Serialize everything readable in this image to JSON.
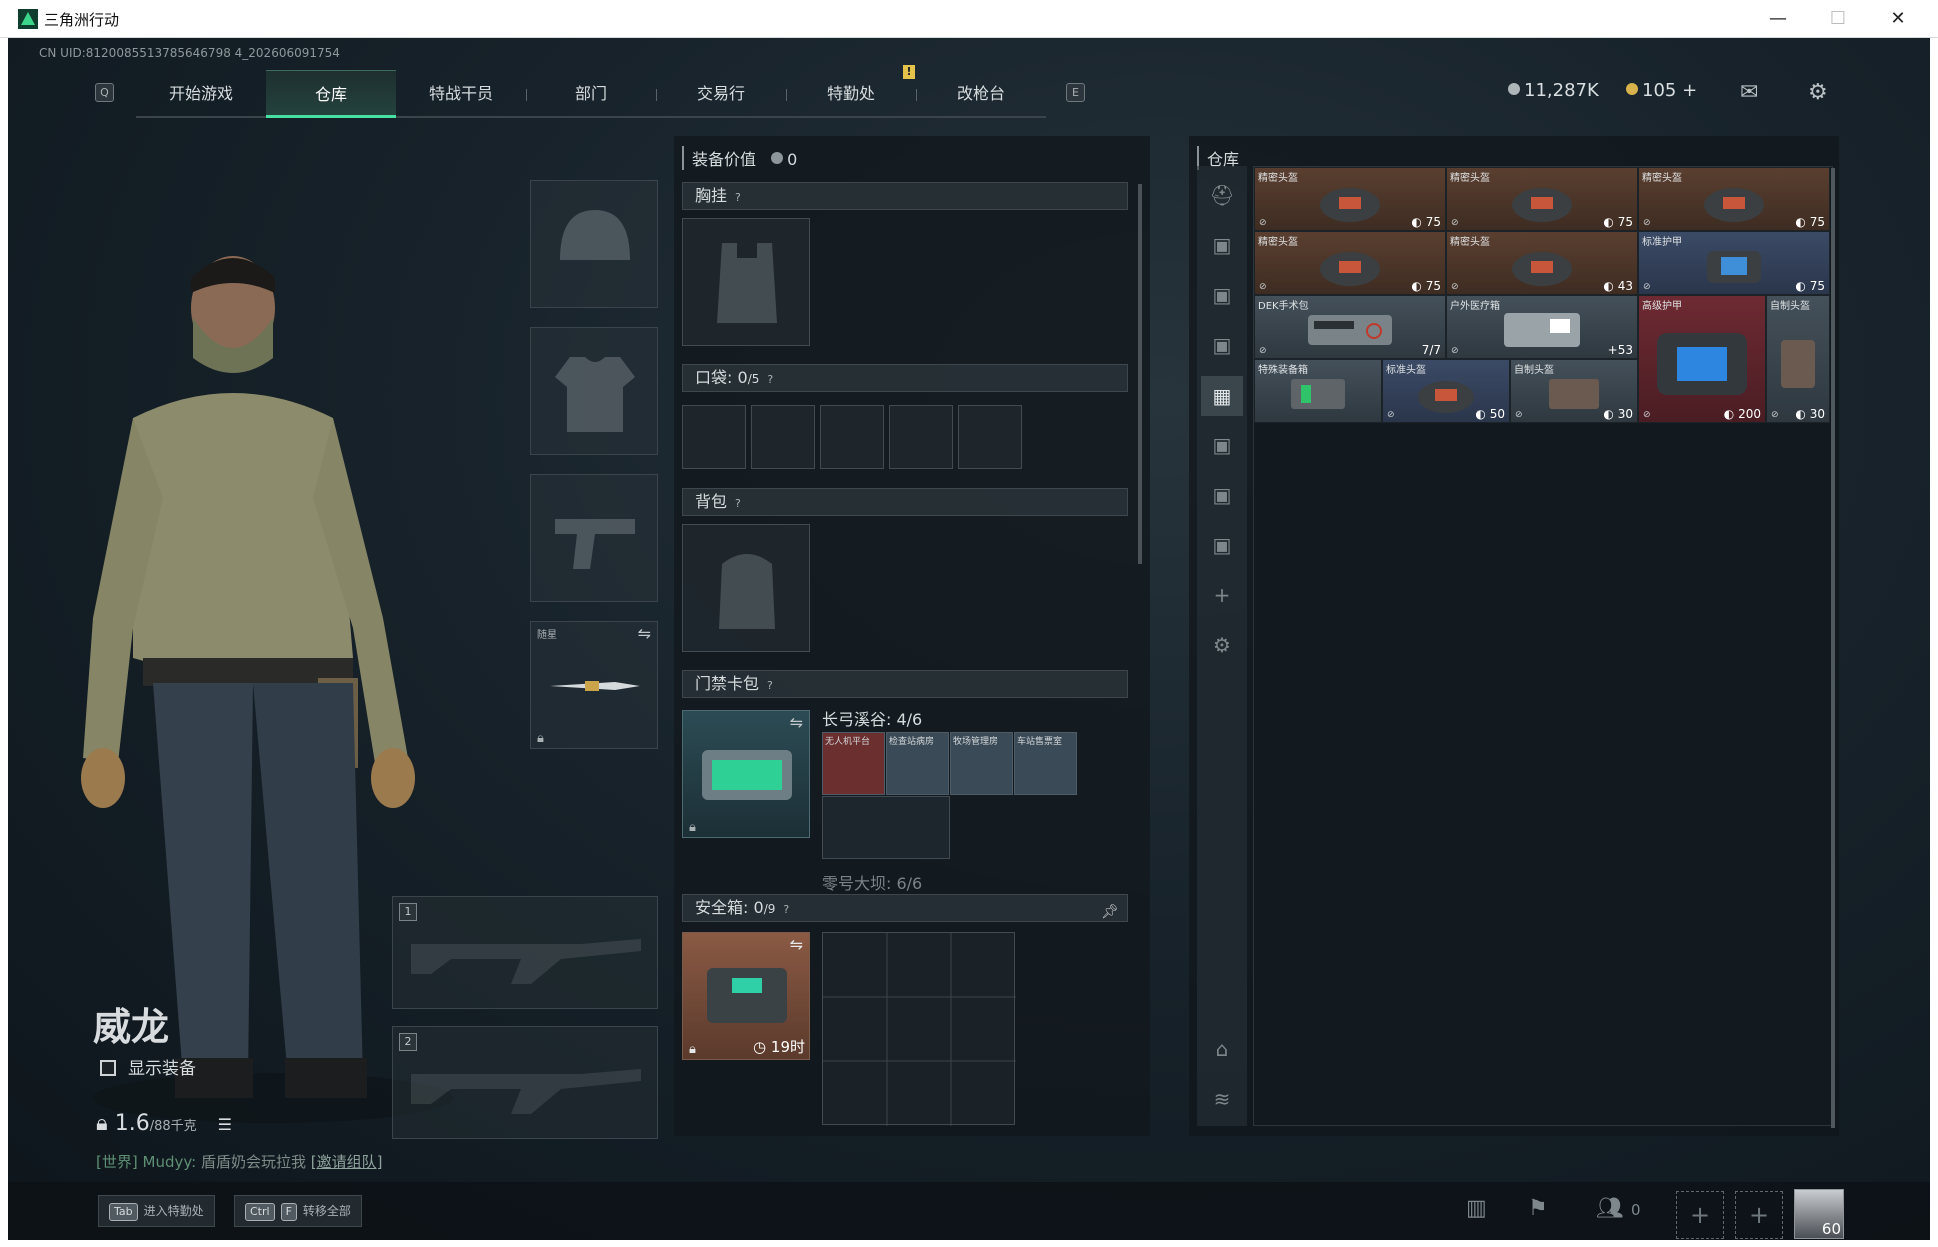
{
  "window": {
    "title": "三角洲行动",
    "controls": [
      "—",
      "☐",
      "✕"
    ]
  },
  "uid": "CN UID:8120085513785646798 4_202606091754",
  "nav": {
    "left_key": "Q",
    "right_key": "E",
    "tabs": [
      {
        "label": "开始游戏",
        "active": false
      },
      {
        "label": "仓库",
        "active": true
      },
      {
        "label": "特战干员",
        "active": false
      },
      {
        "label": "部门",
        "active": false
      },
      {
        "label": "交易行",
        "active": false
      },
      {
        "label": "特勤处",
        "active": false
      },
      {
        "label": "改枪台",
        "active": false
      }
    ],
    "notice_badge": "!"
  },
  "currency": {
    "silver": "11,287K",
    "gold": "105",
    "gold_add": "+"
  },
  "character": {
    "name": "威龙",
    "show_equipment": "显示装备",
    "weight_value": "1.6",
    "weight_max": "/88千克",
    "chat_channel": "[世界]",
    "chat_user": "Mudyy:",
    "chat_msg": "盾盾奶会玩拉我",
    "chat_link": "[邀请组队]"
  },
  "melee": {
    "label": "随星"
  },
  "weapon_slots": [
    "1",
    "2"
  ],
  "equipment": {
    "header": "装备价值",
    "value": "0",
    "chest_rig": "胸挂",
    "pockets": "口袋:",
    "pockets_used": "0",
    "pockets_total": "/5",
    "backpack": "背包",
    "keycard": "门禁卡包",
    "keycard_map1": "长弓溪谷: 4/6",
    "keycard_map2": "零号大坝: 6/6",
    "cards": [
      "无人机平台",
      "检查站病房",
      "牧场管理房",
      "车站售票室"
    ],
    "safe_box": "安全箱:",
    "safe_used": "0",
    "safe_total": "/9",
    "safe_time": "19时",
    "help": "?"
  },
  "warehouse": {
    "title": "仓库",
    "items": [
      {
        "name": "精密头盔",
        "value": "75",
        "color": "brown"
      },
      {
        "name": "精密头盔",
        "value": "75",
        "color": "brown"
      },
      {
        "name": "精密头盔",
        "value": "75",
        "color": "brown"
      },
      {
        "name": "精密头盔",
        "value": "75",
        "color": "brown"
      },
      {
        "name": "精密头盔",
        "value": "43",
        "color": "brown"
      },
      {
        "name": "标准护甲",
        "value": "75",
        "color": "blue"
      },
      {
        "name": "DEK手术包",
        "value": "7/7",
        "color": "gray"
      },
      {
        "name": "户外医疗箱",
        "value": "+53",
        "color": "gray"
      },
      {
        "name": "高级护甲",
        "value": "200",
        "color": "red"
      },
      {
        "name": "自制头盔",
        "value": "30",
        "color": "gray"
      },
      {
        "name": "特殊装备箱",
        "value": "",
        "color": "gray"
      },
      {
        "name": "标准头盔",
        "value": "50",
        "color": "blue"
      },
      {
        "name": "自制头盔",
        "value": "30",
        "color": "gray"
      }
    ]
  },
  "bottom": {
    "hint1_key": "Tab",
    "hint1_text": "进入特勤处",
    "hint2_key1": "Ctrl",
    "hint2_key2": "F",
    "hint2_text": "转移全部",
    "friends_online": "0",
    "player_level": "60"
  },
  "colors": {
    "accent": "#47e0a2",
    "panel": "#12181d",
    "brown_item": "#5a3f30",
    "blue_item": "#3b4a66",
    "red_item": "#6e2a33"
  }
}
